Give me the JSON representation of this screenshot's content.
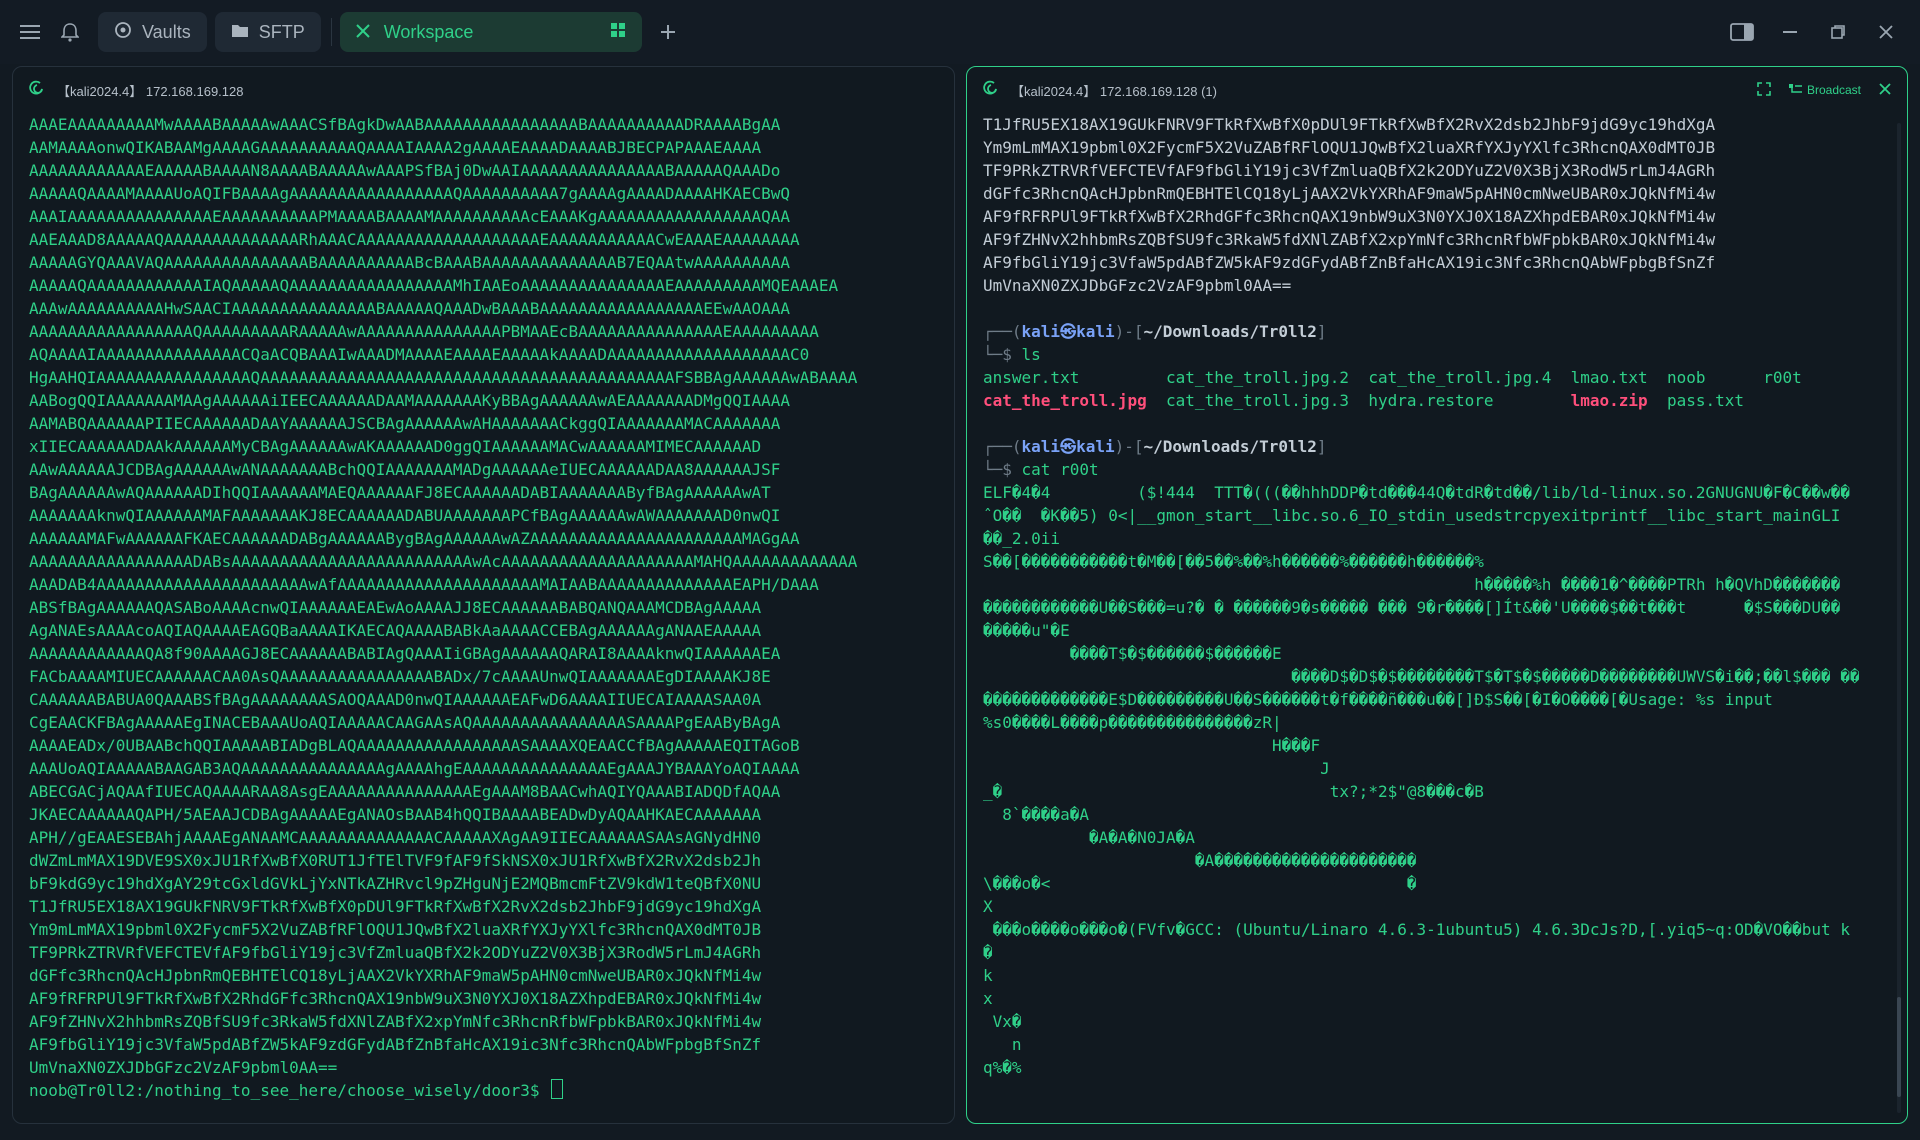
{
  "topbar": {
    "tabs": [
      {
        "label": "Vaults",
        "icon": "vault-icon"
      },
      {
        "label": "SFTP",
        "icon": "folder-icon"
      },
      {
        "label": "Workspace",
        "icon": "close-icon",
        "active": true
      }
    ]
  },
  "left_pane": {
    "title": "【kali2024.4】 172.168.169.128",
    "lines": [
      "AAAEAAAAAAAAAMwAAAABAAAAAwAAACSfBAgkDwAABAAAAAAAAAAAAAAAABAAAAAAAAAADRAAAABgAA",
      "AAMAAAAonwQIKABAAMgAAAAGAAAAAAAAAAQAAAAIAAAA2gAAAAEAAAADAAAABJBECPAPAAAEAAAA",
      "AAAAAAAAAAAAEAAAAABAAAAN8AAAABAAAAAwAAAPSfBAj0DwAAIAAAAAAAAAAAAAAABAAAAAQAAADo",
      "AAAAAQAAAAMAAAAUoAQIFBAAAAgAAAAAAAAAAAAAAAAAQAAAAAAAAAA7gAAAAgAAAADAAAAHKAECBwQ",
      "AAAIAAAAAAAAAAAAAAAEAAAAAAAAAAPMAAAABAAAAMAAAAAAAAAAcEAAAKgAAAAAAAAAAAAAAAAAQAA",
      "AAEAAAD8AAAAAQAAAAAAAAAAAAAARhAAACAAAAAAAAAAAAAAAAAAAEAAAAAAAAAAACwEAAAEAAAAAAAA",
      "AAAAAGYQAAAVAQAAAAAAAAAAAAAAABAAAAAAAAAABcBAAABAAAAAAAAAAAAAAB7EQAAtwAAAAAAAAAA",
      "AAAAAQAAAAAAAAAAAAIAQAAAAAQAAAAAAAAAAAAAAAAAMhIAAEoAAAAAAAAAAAAAAAEAAAAAAAAAMQEAAAEA",
      "AAAwAAAAAAAAAAHwSAACIAAAAAAAAAAAAAAABAAAAAQAAADwBAAABAAAAAAAAAAAAAAAAAEEwAAOAAA",
      "AAAAAAAAAAAAAAAAAQAAAAAAAAARAAAAAwAAAAAAAAAAAAAAAPBMAAEcBAAAAAAAAAAAAAAAEAAAAAAAAA",
      "AQAAAAIAAAAAAAAAAAAAAACQaACQBAAAIwAAADMAAAAEAAAAEAAAAAkAAAADAAAAAAAAAAAAAAAAAAAC0",
      "HgAAHQIAAAAAAAAAAAAAAAAQAAAAAAAAAAAAAAAAAAAAAAAAAAAAAAAAAAAAAAAAAAAFSBBAgAAAAAAwABAAAA",
      "AABogQQIAAAAAAAMAAgAAAAAAiIEECAAAAAADAAMAAAAAAAKyBBAgAAAAAAwAEAAAAAAADMgQQIAAAA",
      "AAMABQAAAAAAPIIECAAAAAADAAYAAAAAAJSCBAgAAAAAAwAHAAAAAAACkggQIAAAAAAAMACAAAAAAA",
      "xIIECAAAAAADAAkAAAAAAMyCBAgAAAAAAwAKAAAAAAD0ggQIAAAAAAMACwAAAAAAMIMECAAAAAAD",
      "AAwAAAAAAJCDBAgAAAAAAwANAAAAAAABchQQIAAAAAAAMADgAAAAAAeIUECAAAAAADAA8AAAAAAJSF",
      "BAgAAAAAAwAQAAAAAADIhQQIAAAAAAMAEQAAAAAAFJ8ECAAAAAADABIAAAAAAAByfBAgAAAAAAwAT",
      "AAAAAAAknwQIAAAAAAMAFAAAAAAAKJ8ECAAAAAADABUAAAAAAAPCfBAgAAAAAAwAWAAAAAAAD0nwQI",
      "AAAAAAMAFwAAAAAAFKAECAAAAAADABgAAAAAABygBAgAAAAAAwAZAAAAAAAAAAAAAAAAAAAAAAMAGgAA",
      "AAAAAAAAAAAAAAAAADABsAAAAAAAAAAAAAAAAAAAAAAAAAwAcAAAAAAAAAAAAAAAAAAAAMAHQAAAAAAAAAAAAA",
      "AAADAB4AAAAAAAAAAAAAAAAAAAAAAwAfAAAAAAAAAAAAAAAAAAAAAMAIAABAAAAAAAAAAAAAAEAPH/DAAA",
      "ABSfBAgAAAAAAQASABoAAAAcnwQIAAAAAAEAEwAoAAAAJJ8ECAAAAAABABQANQAAAMCDBAgAAAAA",
      "AgANAEsAAAAcoAQIAQAAAAEAGQBaAAAAIKAECAQAAAABABkAaAAAACCEBAgAAAAAAgANAAEAAAAA",
      "AAAAAAAAAAAAQA8f90AAAAGJ8ECAAAAAABABIAgQAAAIiGBAgAAAAAAQARAI8AAAAknwQIAAAAAAEA",
      "FACbAAAAMIUECAAAAAACAA0AsQAAAAAAAAAAAAAAAABADx/7cAAAAUnwQIAAAAAAAEgDIAAAAKJ8E",
      "CAAAAAABABUA0QAAABSfBAgAAAAAAAASAOQAAAD0nwQIAAAAAAEAFwD6AAAAIIUECAIAAAASAA0A",
      "CgEAACKFBAgAAAAAEgINACEBAAAUoAQIAAAAACAAGAAsAQAAAAAAAAAAAAAAAASAAAAPgEAAByBAgA",
      "AAAAEADx/0UBAABchQQIAAAAABIADgBLAQAAAAAAAAAAAAAAAAASAAAAXQEAACCfBAgAAAAAEQITAGoB",
      "AAAUoAQIAAAAABAAGAB3AQAAAAAAAAAAAAAAAgAAAAhgEAAAAAAAAAAAAAAAEgAAAJYBAAAYoAQIAAAA",
      "ABECGACjAQAAfIUECAQAAAARAA8AsgEAAAAAAAAAAAAAAAEgAAAM8BAACwhAQIYQAAABIADQDfAQAA",
      "JKAECAAAAAAQAPH/5AEAAJCDBAgAAAAAEgANAOsBAAB4hQQIBAAAABEADwDyAQAAHKAECAAAAAAA",
      "APH//gEAAESEBAhjAAAAEgANAAMCAAAAAAAAAAAAAACAAAAAXAgAA9IIECAAAAAASAAsAGNydHN0",
      "dWZmLmMAX19DVE9SX0xJU1RfXwBfX0RUT1JfTElTVF9fAF9fSkNSX0xJU1RfXwBfX2RvX2dsb2Jh",
      "bF9kdG9yc19hdXgAY29tcGxldGVkLjYxNTkAZHRvcl9pZHguNjE2MQBmcmFtZV9kdW1teQBfX0NU",
      "T1JfRU5EX18AX19GUkFNRV9FTkRfXwBfX0pDUl9FTkRfXwBfX2RvX2dsb2JhbF9jdG9yc19hdXgA",
      "Ym9mLmMAX19pbml0X2FycmF5X2VuZABfRFlOQU1JQwBfX2luaXRfYXJyYXlfc3RhcnQAX0dMT0JB",
      "TF9PRkZTRVRfVEFCTEVfAF9fbGliY19jc3VfZmluaQBfX2k2ODYuZ2V0X3BjX3RodW5rLmJ4AGRh",
      "dGFfc3RhcnQAcHJpbnRmQEBHTElCQ18yLjAAX2VkYXRhAF9maW5pAHN0cmNweUBAR0xJQkNfMi4w",
      "AF9fRFRPUl9FTkRfXwBfX2RhdGFfc3RhcnQAX19nbW9uX3N0YXJ0X18AZXhpdEBAR0xJQkNfMi4w",
      "AF9fZHNvX2hhbmRsZQBfSU9fc3RkaW5fdXNlZABfX2xpYmNfc3RhcnRfbWFpbkBAR0xJQkNfMi4w",
      "AF9fbGliY19jc3VfaW5pdABfZW5kAF9zdGFydABfZnBfaHcAX19ic3Nfc3RhcnQAbWFpbgBfSnZf",
      "UmVnaXN0ZXJDbGFzc2VzAF9pbml0AA==",
      "noob@Tr0ll2:/nothing_to_see_here/choose_wisely/door3$ "
    ]
  },
  "right_pane": {
    "title": "【kali2024.4】 172.168.169.128 (1)",
    "broadcast_label": "Broadcast",
    "base64_tail": [
      "T1JfRU5EX18AX19GUkFNRV9FTkRfXwBfX0pDUl9FTkRfXwBfX2RvX2dsb2JhbF9jdG9yc19hdXgA",
      "Ym9mLmMAX19pbml0X2FycmF5X2VuZABfRFlOQU1JQwBfX2luaXRfYXJyYXlfc3RhcnQAX0dMT0JB",
      "TF9PRkZTRVRfVEFCTEVfAF9fbGliY19jc3VfZmluaQBfX2k2ODYuZ2V0X3BjX3RodW5rLmJ4AGRh",
      "dGFfc3RhcnQAcHJpbnRmQEBHTElCQ18yLjAAX2VkYXRhAF9maW5pAHN0cmNweUBAR0xJQkNfMi4w",
      "AF9fRFRPUl9FTkRfXwBfX2RhdGFfc3RhcnQAX19nbW9uX3N0YXJ0X18AZXhpdEBAR0xJQkNfMi4w",
      "AF9fZHNvX2hhbmRsZQBfSU9fc3RkaW5fdXNlZABfX2xpYmNfc3RhcnRfbWFpbkBAR0xJQkNfMi4w",
      "AF9fbGliY19jc3VfaW5pdABfZW5kAF9zdGFydABfZnBfaHcAX19ic3Nfc3RhcnQAbWFpbgBfSnZf",
      "UmVnaXN0ZXJDbGFzc2VzAF9pbml0AA=="
    ],
    "prompt1": {
      "head": "┌──(",
      "user": "kali㉿kali",
      "mid": ")-[",
      "path": "~/Downloads/Tr0ll2",
      "tail": "]",
      "line2": "└─$ ",
      "cmd": "ls"
    },
    "ls_row1": [
      "answer.txt",
      "cat_the_troll.jpg.2",
      "cat_the_troll.jpg.4",
      "lmao.txt",
      "noob",
      "r00t"
    ],
    "ls_row2": [
      "cat_the_troll.jpg",
      "cat_the_troll.jpg.3",
      "hydra.restore",
      "lmao.zip",
      "pass.txt"
    ],
    "prompt2": {
      "head": "┌──(",
      "user": "kali㉿kali",
      "mid": ")-[",
      "path": "~/Downloads/Tr0ll2",
      "tail": "]",
      "line2": "└─$ ",
      "cmd": "cat",
      "arg": "r00t"
    },
    "binary_output": [
      "ELF�4�4         ($!444  TTT�(((��hhhDDP�td���44Q�tdR�td��/lib/ld-linux.so.2GNUGNU�F�C��w��",
      "ˆO��  �K��5) 0<|__gmon_start__libc.so.6_IO_stdin_usedstrcpyexitprintf__libc_start_mainGLI",
      "��_2.0ii",
      "S��[�����������t�M��[��5��%��%h������%������h������%",
      "                                                   h�����%h ����1�^����PTRh h�QVhD�������",
      "������������U��S���=u?� � ������9�s����� ��� 9�r����[]Ít&��'U����$��t���t      �$S���DU��",
      "�����u\"�E",
      "         ����T$�$������$������E",
      "                                ����D$�D$�$��������T$�T$�$�����D��������UWVS�i��;��l$��� ��",
      "�������������E$D���������U��S������t�f����ñ���u��[]Ð$S��[�I�O����[�Usage: %s input",
      "%s0����L����p���������������zR|",
      "                              H���F",
      "                                   J",
      "_�                                  tx?;*2$\"@8���c�B",
      "  8`����a�A",
      "           �A�A�N0JA�A",
      "                      �A���������������������",
      "\\���o�<                                     �",
      "X",
      " ���o����o���o�(FVfv�GCC: (Ubuntu/Linaro 4.6.3-1ubuntu5) 4.6.3DcJs?D,[.yiq5~q:OD�VO��but k",
      "�",
      "k",
      "x",
      " Vx�",
      "   n",
      "q%�%"
    ]
  }
}
